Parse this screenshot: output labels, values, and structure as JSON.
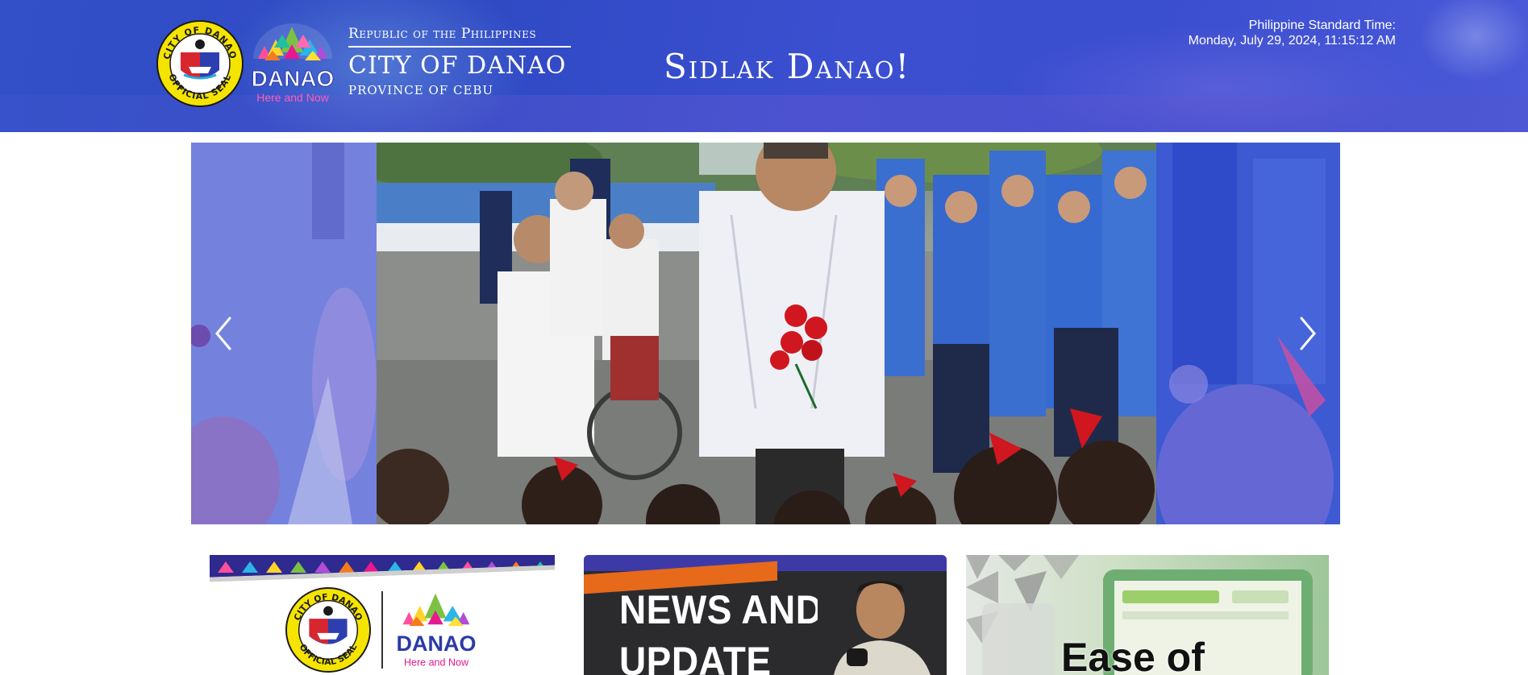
{
  "header": {
    "gov_line1": "Republic of the Philippines",
    "gov_line2": "CITY OF DANAO",
    "gov_line3": "PROVINCE OF CEBU",
    "slogan": "Sidlak Danao!",
    "pst_label": "Philippine Standard Time:",
    "pst_value": "Monday, July 29, 2024, 11:15:12 AM",
    "seal_text_top": "CITY OF DANAO",
    "seal_text_bottom": "OFFICIAL SEAL",
    "logo_text": "DANAO",
    "logo_tagline": "Here and Now"
  },
  "carousel": {
    "prev_icon": "chevron-left-icon",
    "next_icon": "chevron-right-icon"
  },
  "cards": {
    "card1_logo_text": "DANAO",
    "card1_logo_tagline": "Here and Now",
    "card1_seal_top": "CITY OF DANAO",
    "card1_seal_bottom": "OFFICIAL SEAL",
    "card2_title": "NEWS AND\nUPDATE",
    "card3_title": "Ease of"
  },
  "colors": {
    "header_blue": "#3350c8",
    "brand_pink": "#e8188f",
    "brand_blue": "#2b3aa8",
    "seal_yellow": "#f5e400"
  }
}
